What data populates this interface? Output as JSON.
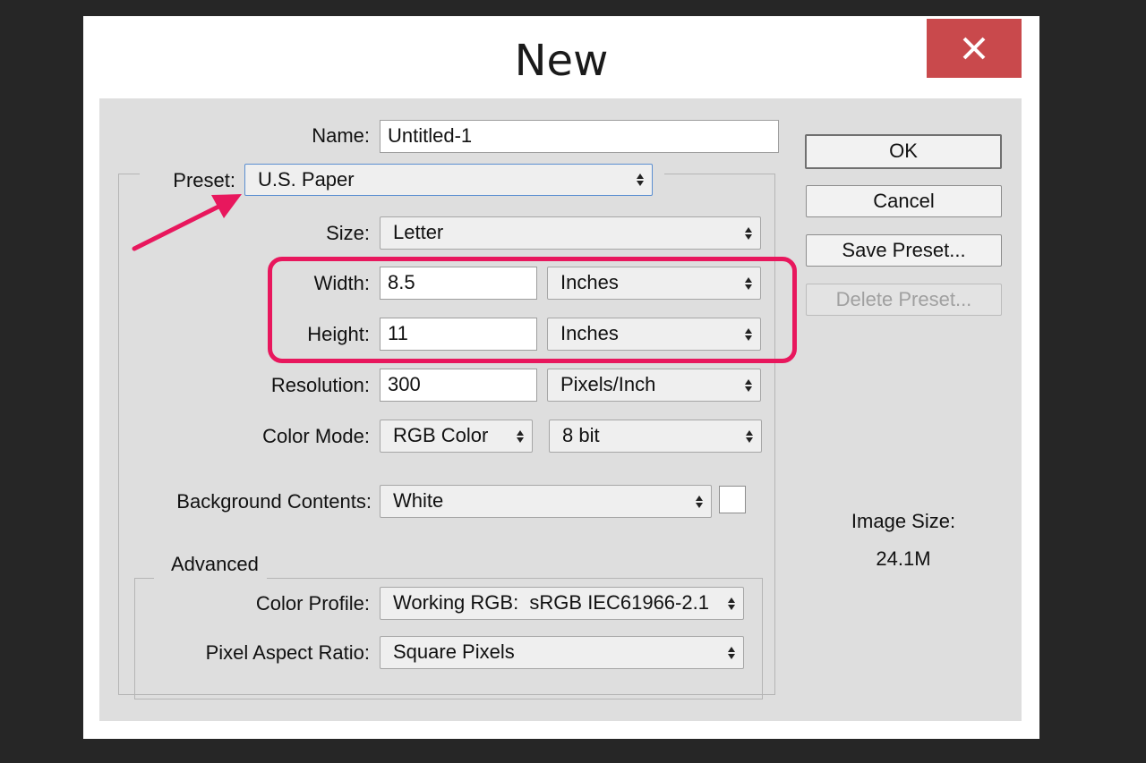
{
  "dialog": {
    "title": "New",
    "close_icon": "close-icon"
  },
  "form": {
    "name_label": "Name:",
    "name_value": "Untitled-1",
    "preset_label": "Preset:",
    "preset_value": "U.S. Paper",
    "size_label": "Size:",
    "size_value": "Letter",
    "width_label": "Width:",
    "width_value": "8.5",
    "width_unit": "Inches",
    "height_label": "Height:",
    "height_value": "11",
    "height_unit": "Inches",
    "resolution_label": "Resolution:",
    "resolution_value": "300",
    "resolution_unit": "Pixels/Inch",
    "color_mode_label": "Color Mode:",
    "color_mode_value": "RGB Color",
    "bit_depth_value": "8 bit",
    "background_label": "Background Contents:",
    "background_value": "White",
    "background_swatch_color": "#ffffff"
  },
  "advanced": {
    "legend": "Advanced",
    "color_profile_label": "Color Profile:",
    "color_profile_value": "Working RGB:  sRGB IEC61966-2.1",
    "pixel_aspect_label": "Pixel Aspect Ratio:",
    "pixel_aspect_value": "Square Pixels"
  },
  "buttons": {
    "ok": "OK",
    "cancel": "Cancel",
    "save_preset": "Save Preset...",
    "delete_preset": "Delete Preset..."
  },
  "image_size": {
    "label": "Image Size:",
    "value": "24.1M"
  },
  "annotation": {
    "color": "#e8175d"
  }
}
